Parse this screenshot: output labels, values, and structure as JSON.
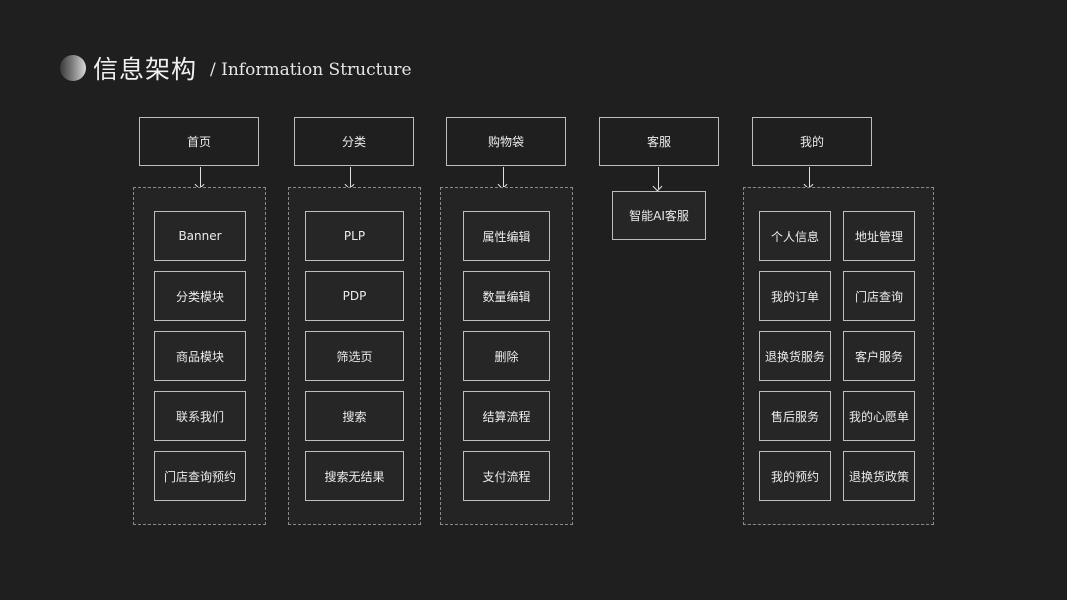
{
  "title": {
    "cn": "信息架构",
    "en": "/ Information Structure"
  },
  "columns": [
    {
      "header": "首页",
      "items": [
        "Banner",
        "分类模块",
        "商品模块",
        "联系我们",
        "门店查询预约"
      ]
    },
    {
      "header": "分类",
      "items": [
        "PLP",
        "PDP",
        "筛选页",
        "搜索",
        "搜索无结果"
      ]
    },
    {
      "header": "购物袋",
      "items": [
        "属性编辑",
        "数量编辑",
        "删除",
        "结算流程",
        "支付流程"
      ]
    },
    {
      "header": "客服",
      "items": [
        "智能AI客服"
      ]
    },
    {
      "header": "我的",
      "items": [
        "个人信息",
        "地址管理",
        "我的订单",
        "门店查询",
        "退换货服务",
        "客户服务",
        "售后服务",
        "我的心愿单",
        "我的预约",
        "退换货政策"
      ]
    }
  ]
}
